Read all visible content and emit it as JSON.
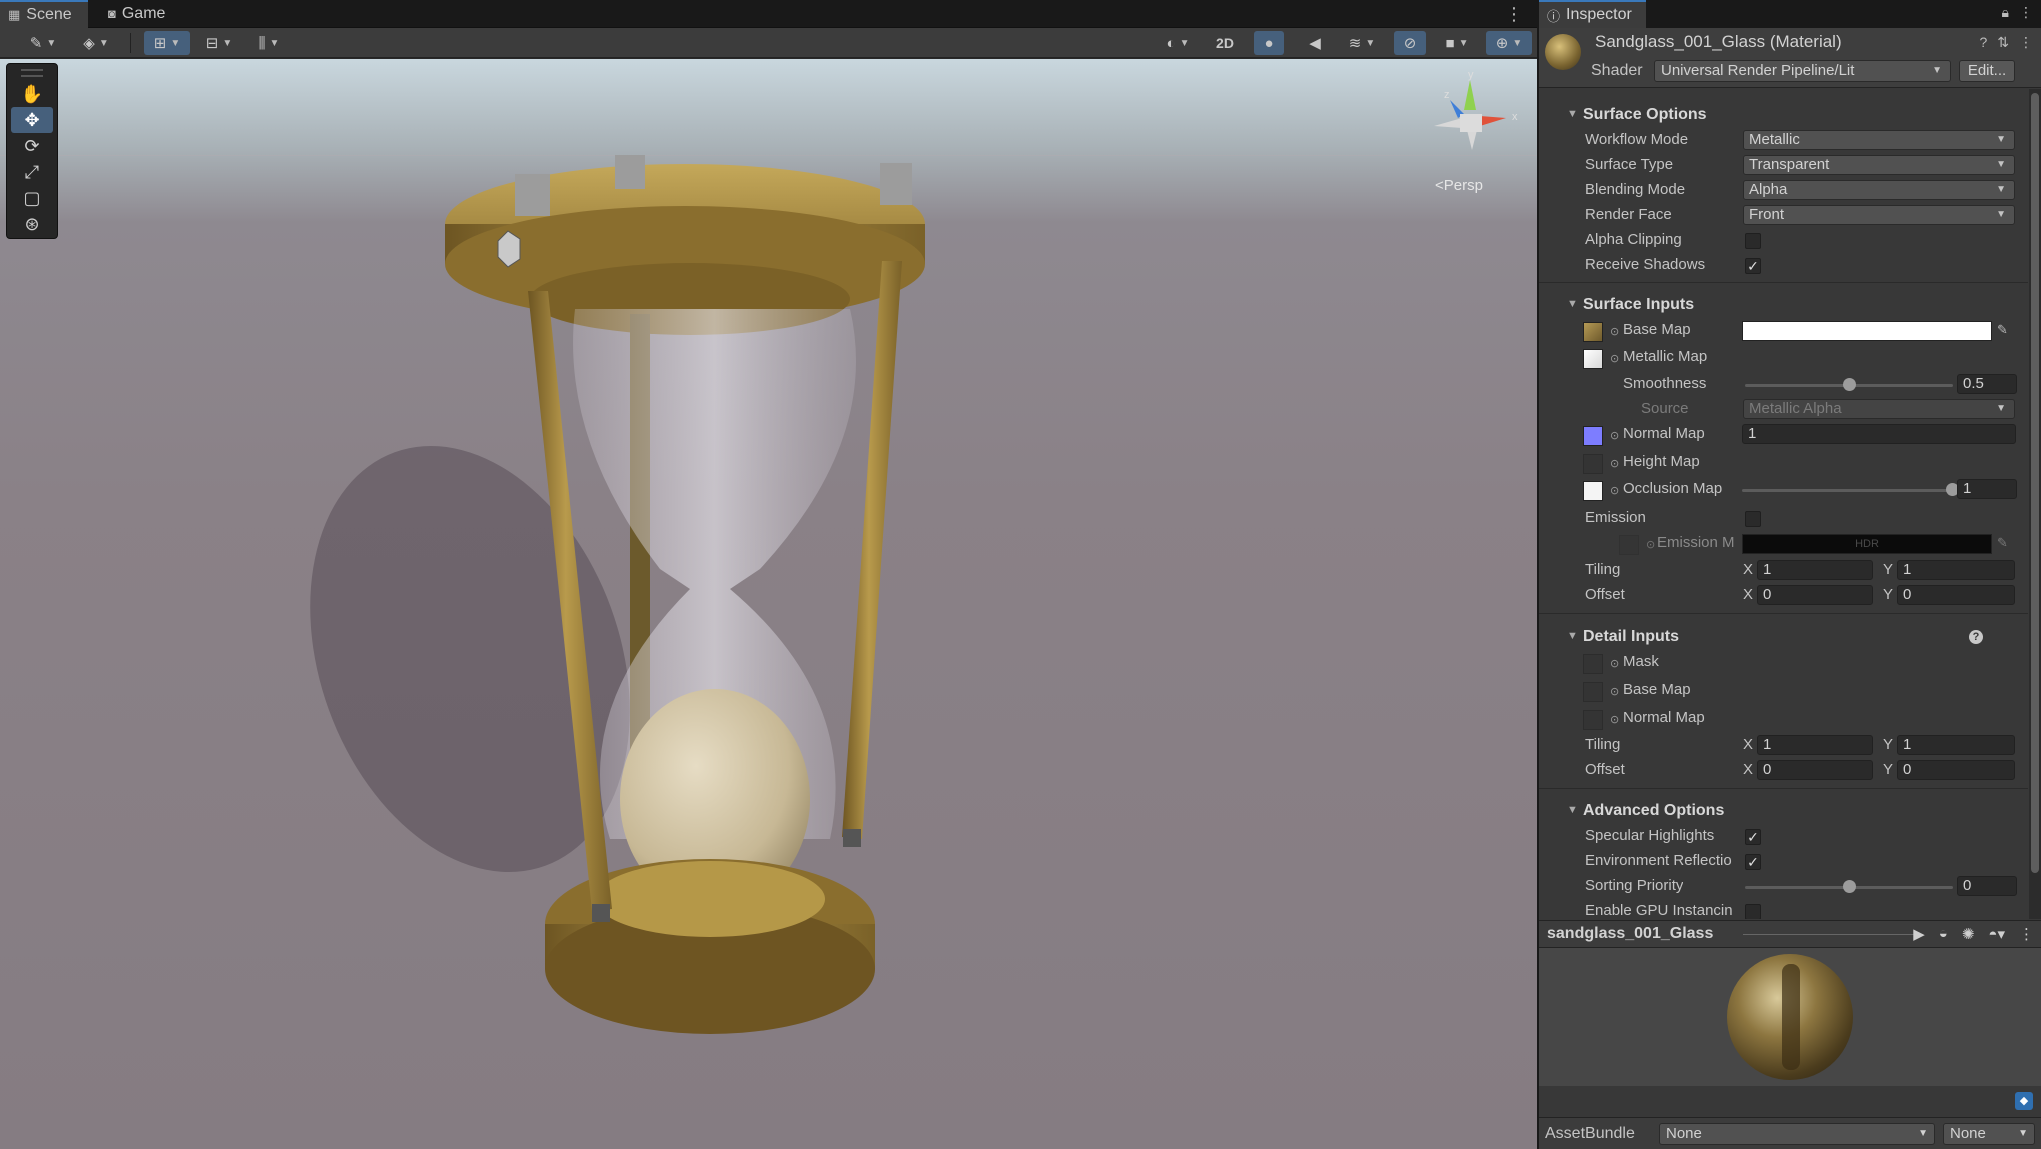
{
  "scene_tabs": {
    "scene": "Scene",
    "game": "Game"
  },
  "scene_toolbar": {
    "mode_2d": "2D"
  },
  "scene_view": {
    "projection_label": "<Persp",
    "gizmo_y": "y",
    "gizmo_x": "x",
    "gizmo_z": "z"
  },
  "inspector": {
    "tab_label": "Inspector",
    "material_title": "Sandglass_001_Glass (Material)",
    "shader_label": "Shader",
    "shader_value": "Universal Render Pipeline/Lit",
    "edit_button": "Edit..."
  },
  "surface_options": {
    "title": "Surface Options",
    "workflow_mode": {
      "label": "Workflow Mode",
      "value": "Metallic"
    },
    "surface_type": {
      "label": "Surface Type",
      "value": "Transparent"
    },
    "blending_mode": {
      "label": "Blending Mode",
      "value": "Alpha"
    },
    "render_face": {
      "label": "Render Face",
      "value": "Front"
    },
    "alpha_clipping": {
      "label": "Alpha Clipping",
      "checked": false
    },
    "receive_shadows": {
      "label": "Receive Shadows",
      "checked": true
    }
  },
  "surface_inputs": {
    "title": "Surface Inputs",
    "base_map": "Base Map",
    "metallic_map": "Metallic Map",
    "smoothness": {
      "label": "Smoothness",
      "value": "0.5",
      "fraction": 0.5
    },
    "source": {
      "label": "Source",
      "value": "Metallic Alpha"
    },
    "normal_map": {
      "label": "Normal Map",
      "value": "1"
    },
    "height_map": "Height Map",
    "occlusion_map": {
      "label": "Occlusion Map",
      "value": "1",
      "fraction": 1.0
    },
    "emission": "Emission",
    "emission_map": "Emission M",
    "hdr": "HDR",
    "tiling": {
      "label": "Tiling",
      "x_label": "X",
      "x": "1",
      "y_label": "Y",
      "y": "1"
    },
    "offset": {
      "label": "Offset",
      "x_label": "X",
      "x": "0",
      "y_label": "Y",
      "y": "0"
    }
  },
  "detail_inputs": {
    "title": "Detail Inputs",
    "help": "?",
    "mask": "Mask",
    "base_map": "Base Map",
    "normal_map": "Normal Map",
    "tiling": {
      "label": "Tiling",
      "x_label": "X",
      "x": "1",
      "y_label": "Y",
      "y": "1"
    },
    "offset": {
      "label": "Offset",
      "x_label": "X",
      "x": "0",
      "y_label": "Y",
      "y": "0"
    }
  },
  "advanced_options": {
    "title": "Advanced Options",
    "specular_highlights": {
      "label": "Specular Highlights",
      "checked": true
    },
    "environment_reflections": {
      "label": "Environment Reflectio",
      "checked": true
    },
    "sorting_priority": {
      "label": "Sorting Priority",
      "value": "0",
      "fraction": 0.5
    },
    "gpu_instancing": {
      "label": "Enable GPU Instancin",
      "checked": false
    }
  },
  "preview": {
    "title": "sandglass_001_Glass"
  },
  "asset_bundle": {
    "label": "AssetBundle",
    "name": "None",
    "variant": "None"
  },
  "colors": {
    "accent": "#3a79bb",
    "active_tool": "#46607c",
    "brass": "#a88a3a"
  }
}
